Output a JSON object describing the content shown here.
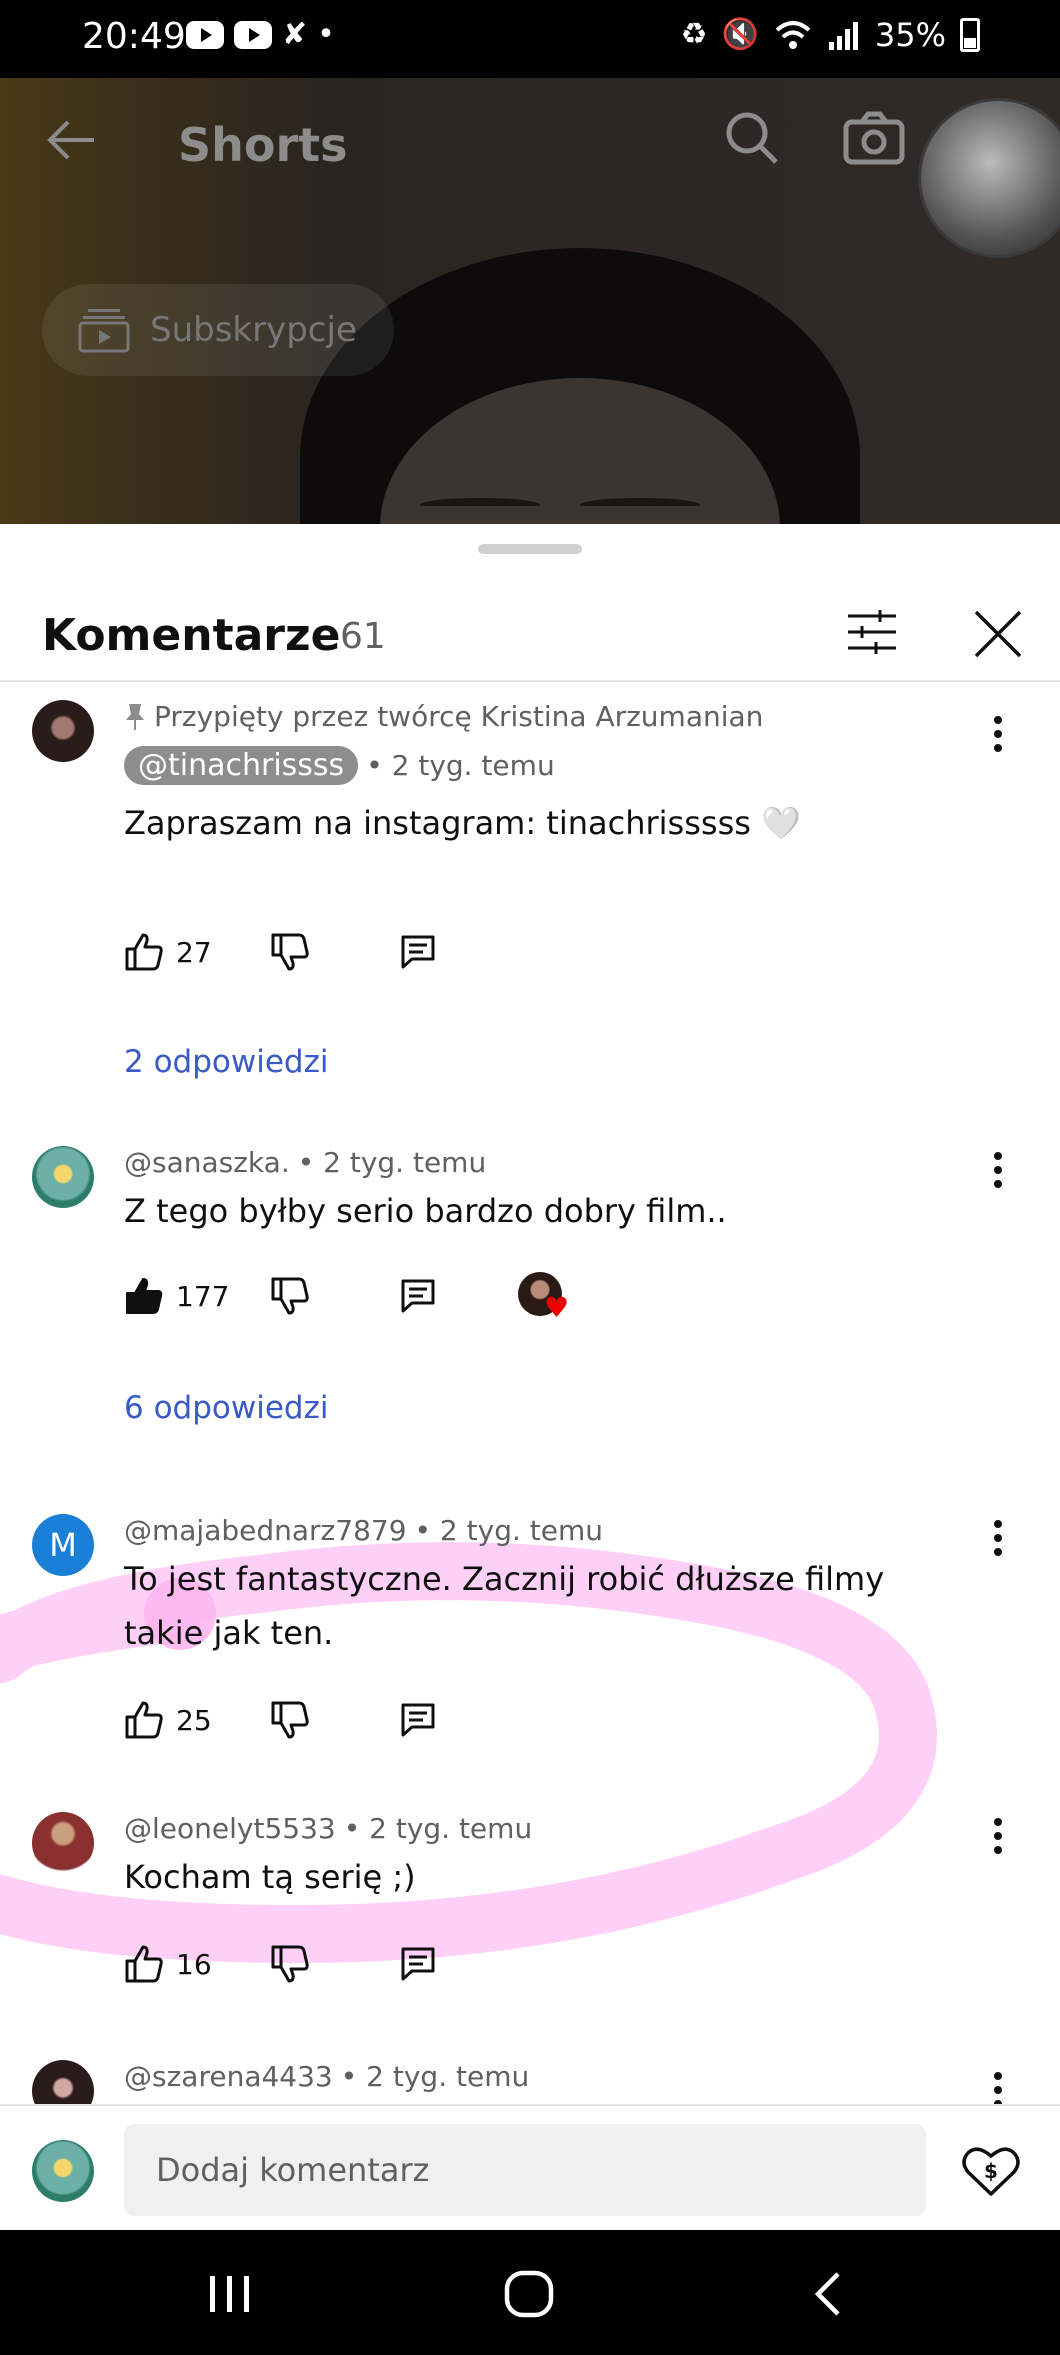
{
  "status_bar": {
    "time": "20:49",
    "battery": "35%"
  },
  "top_bar": {
    "title": "Shorts",
    "subscriptions_chip": "Subskrypcje"
  },
  "comments": {
    "title": "Komentarze",
    "count": "61",
    "items": [
      {
        "pinned_label": "Przypięty przez twórcę Kristina Arzumanian",
        "author": "@tinachrissss",
        "time": "• 2 tyg. temu",
        "text": "Zapraszam na instagram: tinachrisssss 🤍",
        "likes": "27",
        "replies": "2 odpowiedzi",
        "liked": false,
        "creator_heart": false,
        "avatar_color": "#3a2a28"
      },
      {
        "author": "@sanaszka.",
        "time": "• 2 tyg. temu",
        "text": "Z tego byłby serio bardzo dobry film..",
        "likes": "177",
        "replies": "6 odpowiedzi",
        "liked": true,
        "creator_heart": true,
        "avatar_color": "#6cb0a8"
      },
      {
        "author": "@majabednarz7879",
        "time": "• 2 tyg. temu",
        "text_line1": "To jest fantastyczne. Zacznij robić dłuższe filmy",
        "text_line2": "takie jak ten.",
        "likes": "25",
        "avatar_letter": "M",
        "avatar_color": "#1a7fd6"
      },
      {
        "author": "@leonelyt5533",
        "time": "• 2 tyg. temu",
        "text": "Kocham tą serię ;)",
        "likes": "16",
        "avatar_color": "#8a3030"
      },
      {
        "author": "@szarena4433",
        "time": "• 2 tyg. temu",
        "avatar_color": "#2a1c1c"
      }
    ]
  },
  "composer": {
    "placeholder": "Dodaj komentarz"
  },
  "colors": {
    "reply_link": "#3a5ac8",
    "scribble": "#ffc8f6",
    "heart": "#e00000"
  }
}
